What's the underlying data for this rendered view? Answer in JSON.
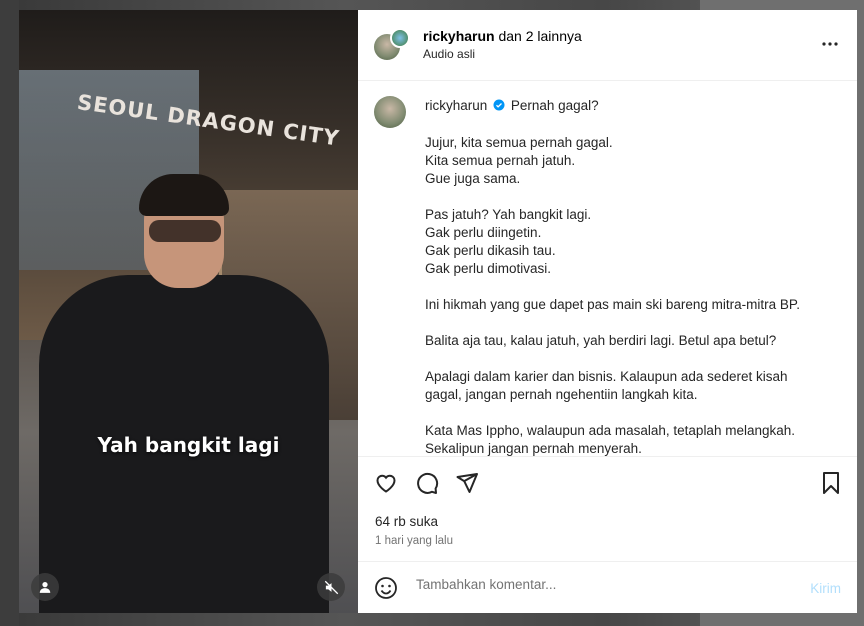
{
  "video": {
    "sign_text": "SEOUL DRAGON CITY",
    "caption": "Yah bangkit lagi",
    "user_icon": "person-icon",
    "mute_icon": "speaker-muted-icon"
  },
  "header": {
    "username": "rickyharun",
    "collab_text": " dan 2 lainnya",
    "audio": "Audio asli",
    "more_icon": "more-horizontal-icon"
  },
  "post": {
    "username": "rickyharun",
    "verified_icon": "verified-badge-icon",
    "title": "Pernah gagal?",
    "lines": [
      "Jujur, kita semua pernah gagal.",
      "Kita semua pernah jatuh.",
      "Gue juga sama.",
      "",
      "Pas jatuh? Yah bangkit lagi.",
      "Gak perlu diingetin.",
      "Gak perlu dikasih tau.",
      "Gak perlu dimotivasi.",
      "",
      "Ini hikmah yang gue dapet pas main ski bareng mitra-mitra BP.",
      "",
      "Balita aja tau, kalau jatuh, yah berdiri lagi. Betul apa betul?",
      "",
      "Apalagi dalam karier dan bisnis. Kalaupun ada sederet kisah",
      "gagal, jangan pernah ngehentiin langkah kita.",
      "",
      "Kata Mas Ippho, walaupun ada masalah, tetaplah melangkah.",
      "Sekalipun jangan pernah menyerah."
    ]
  },
  "actions": {
    "likes": "64 rb suka",
    "time": "1 hari yang lalu"
  },
  "comment": {
    "placeholder": "Tambahkan komentar...",
    "post_label": "Kirim"
  }
}
